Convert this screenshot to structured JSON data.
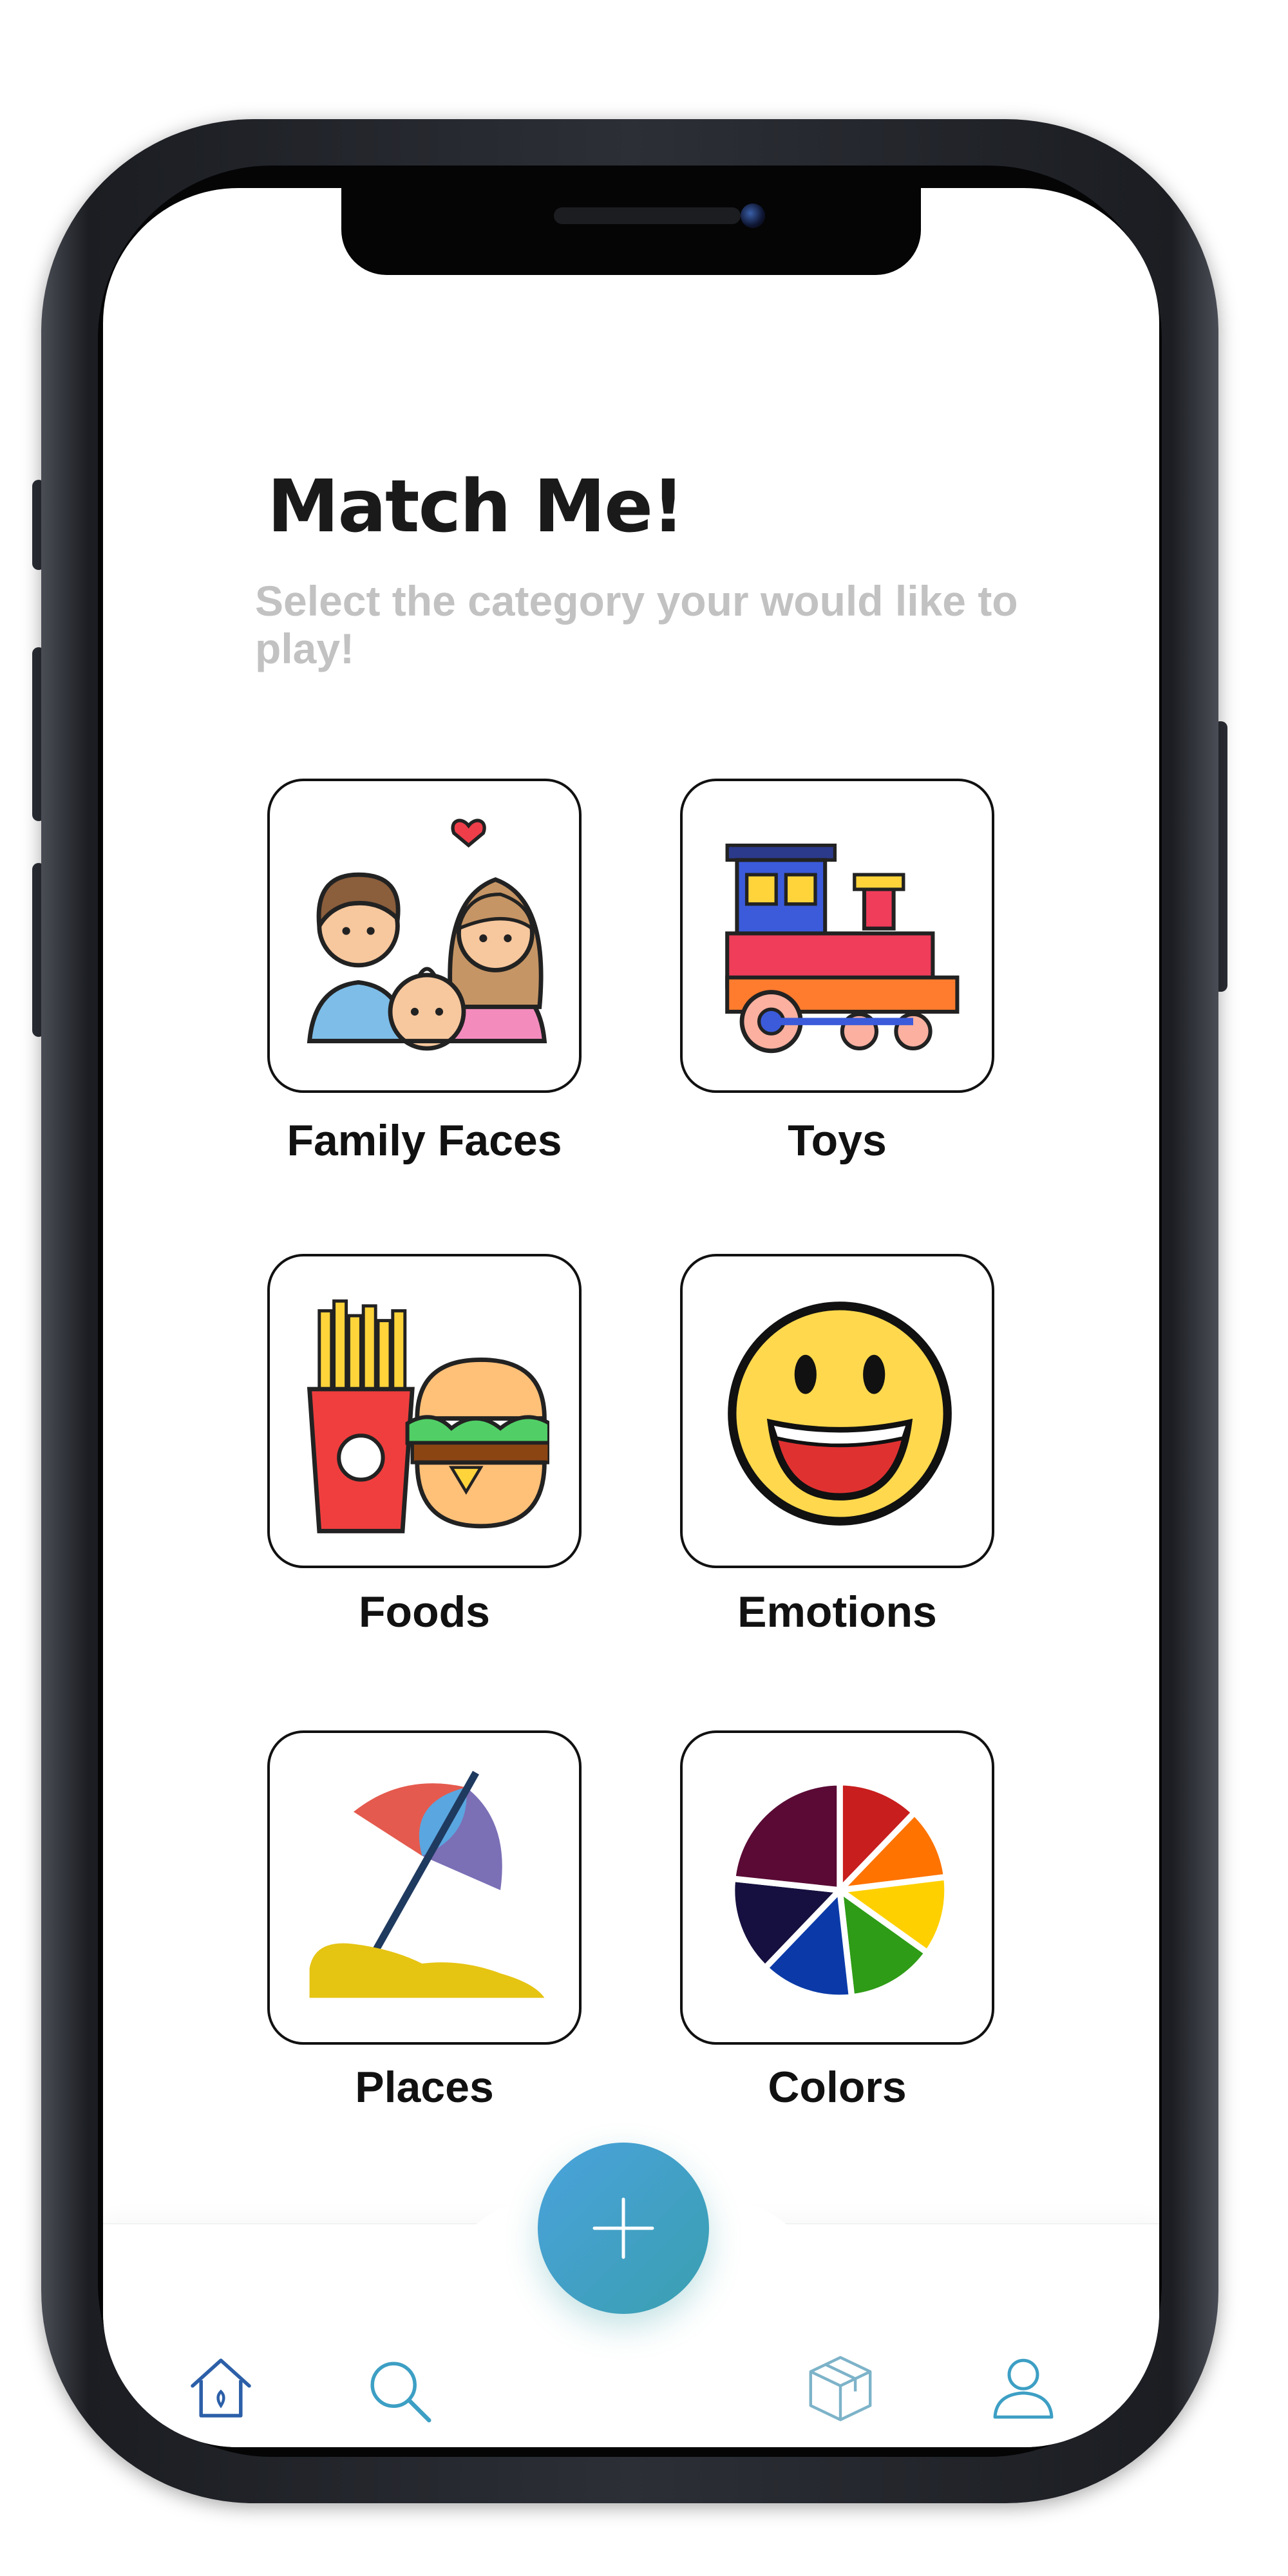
{
  "app": {
    "title": "Match Me!",
    "subtitle": "Select the category your would like to play!"
  },
  "categories": [
    {
      "label": "Family Faces",
      "icon": "family-icon"
    },
    {
      "label": "Toys",
      "icon": "toy-train-icon"
    },
    {
      "label": "Foods",
      "icon": "fast-food-icon"
    },
    {
      "label": "Emotions",
      "icon": "smiley-icon"
    },
    {
      "label": "Places",
      "icon": "beach-umbrella-icon"
    },
    {
      "label": "Colors",
      "icon": "color-wheel-icon"
    }
  ],
  "tabbar": {
    "items": [
      {
        "icon": "home-icon"
      },
      {
        "icon": "search-icon"
      },
      {
        "icon": "add-icon"
      },
      {
        "icon": "box-icon"
      },
      {
        "icon": "profile-icon"
      }
    ],
    "accent_color": "#3d9fc4"
  }
}
